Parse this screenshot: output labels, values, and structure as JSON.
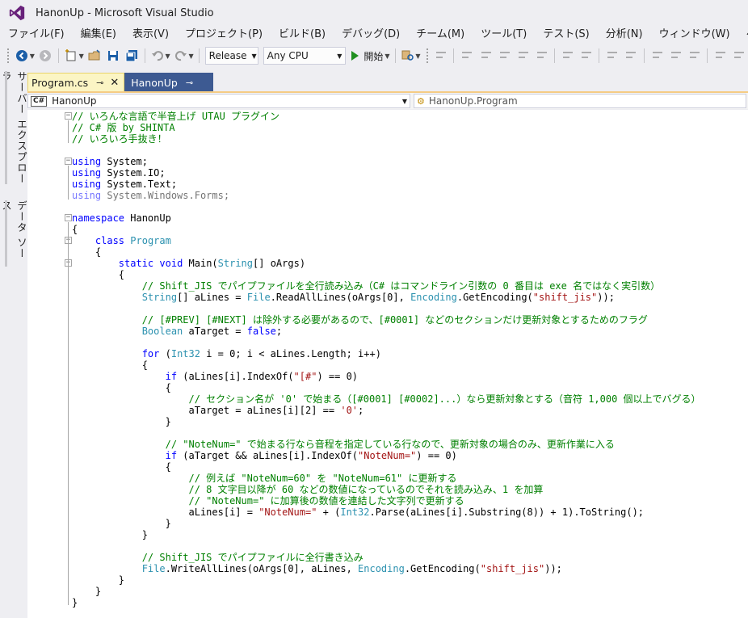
{
  "window": {
    "title": "HanonUp - Microsoft Visual Studio"
  },
  "menu": [
    "ファイル(F)",
    "編集(E)",
    "表示(V)",
    "プロジェクト(P)",
    "ビルド(B)",
    "デバッグ(D)",
    "チーム(M)",
    "ツール(T)",
    "テスト(S)",
    "分析(N)",
    "ウィンドウ(W)",
    "ヘルプ(H)"
  ],
  "toolbar": {
    "config": "Release",
    "platform": "Any CPU",
    "start_label": "開始"
  },
  "sidebar": {
    "server_explorer": "サーバー エクスプローラー",
    "data_sources": "データ ソース"
  },
  "tabs": [
    {
      "label": "Program.cs",
      "active": true
    },
    {
      "label": "HanonUp",
      "active": false
    }
  ],
  "navbar": {
    "project": "HanonUp",
    "project_badge": "C#",
    "member": "HanonUp.Program"
  },
  "code": [
    [
      [
        "cmt",
        "// いろんな言語で半音上げ UTAU プラグイン"
      ]
    ],
    [
      [
        "cmt",
        "// C# 版 by SHINTA"
      ]
    ],
    [
      [
        "cmt",
        "// いろいろ手抜き！"
      ]
    ],
    [
      [
        "txt",
        ""
      ]
    ],
    [
      [
        "kw",
        "using"
      ],
      [
        "txt",
        " System;"
      ]
    ],
    [
      [
        "kw",
        "using"
      ],
      [
        "txt",
        " System.IO;"
      ]
    ],
    [
      [
        "kw",
        "using"
      ],
      [
        "txt",
        " System.Text;"
      ]
    ],
    [
      [
        "kwdim",
        "using"
      ],
      [
        "dim",
        " System.Windows.Forms;"
      ]
    ],
    [
      [
        "txt",
        ""
      ]
    ],
    [
      [
        "kw",
        "namespace"
      ],
      [
        "txt",
        " HanonUp"
      ]
    ],
    [
      [
        "txt",
        "{"
      ]
    ],
    [
      [
        "txt",
        "    "
      ],
      [
        "kw",
        "class"
      ],
      [
        "txt",
        " "
      ],
      [
        "ty",
        "Program"
      ]
    ],
    [
      [
        "txt",
        "    {"
      ]
    ],
    [
      [
        "txt",
        "        "
      ],
      [
        "kw",
        "static"
      ],
      [
        "txt",
        " "
      ],
      [
        "kw",
        "void"
      ],
      [
        "txt",
        " Main("
      ],
      [
        "ty",
        "String"
      ],
      [
        "txt",
        "[] oArgs)"
      ]
    ],
    [
      [
        "txt",
        "        {"
      ]
    ],
    [
      [
        "txt",
        "            "
      ],
      [
        "cmt",
        "// Shift_JIS でパイプファイルを全行読み込み（C# はコマンドライン引数の 0 番目は exe 名ではなく実引数）"
      ]
    ],
    [
      [
        "txt",
        "            "
      ],
      [
        "ty",
        "String"
      ],
      [
        "txt",
        "[] aLines = "
      ],
      [
        "ty",
        "File"
      ],
      [
        "txt",
        ".ReadAllLines(oArgs[0], "
      ],
      [
        "ty",
        "Encoding"
      ],
      [
        "txt",
        ".GetEncoding("
      ],
      [
        "str",
        "\"shift_jis\""
      ],
      [
        "txt",
        "));"
      ]
    ],
    [
      [
        "txt",
        ""
      ]
    ],
    [
      [
        "txt",
        "            "
      ],
      [
        "cmt",
        "// [#PREV] [#NEXT] は除外する必要があるので、[#0001] などのセクションだけ更新対象とするためのフラグ"
      ]
    ],
    [
      [
        "txt",
        "            "
      ],
      [
        "ty",
        "Boolean"
      ],
      [
        "txt",
        " aTarget = "
      ],
      [
        "kw",
        "false"
      ],
      [
        "txt",
        ";"
      ]
    ],
    [
      [
        "txt",
        ""
      ]
    ],
    [
      [
        "txt",
        "            "
      ],
      [
        "kw",
        "for"
      ],
      [
        "txt",
        " ("
      ],
      [
        "ty",
        "Int32"
      ],
      [
        "txt",
        " i = 0; i < aLines.Length; i++)"
      ]
    ],
    [
      [
        "txt",
        "            {"
      ]
    ],
    [
      [
        "txt",
        "                "
      ],
      [
        "kw",
        "if"
      ],
      [
        "txt",
        " (aLines[i].IndexOf("
      ],
      [
        "str",
        "\"[#\""
      ],
      [
        "txt",
        ") == 0)"
      ]
    ],
    [
      [
        "txt",
        "                {"
      ]
    ],
    [
      [
        "txt",
        "                    "
      ],
      [
        "cmt",
        "// セクション名が '0' で始まる（[#0001] [#0002]...）なら更新対象とする（音符 1,000 個以上でバグる）"
      ]
    ],
    [
      [
        "txt",
        "                    aTarget = aLines[i][2] == "
      ],
      [
        "str",
        "'0'"
      ],
      [
        "txt",
        ";"
      ]
    ],
    [
      [
        "txt",
        "                }"
      ]
    ],
    [
      [
        "txt",
        ""
      ]
    ],
    [
      [
        "txt",
        "                "
      ],
      [
        "cmt",
        "// \"NoteNum=\" で始まる行なら音程を指定している行なので、更新対象の場合のみ、更新作業に入る"
      ]
    ],
    [
      [
        "txt",
        "                "
      ],
      [
        "kw",
        "if"
      ],
      [
        "txt",
        " (aTarget && aLines[i].IndexOf("
      ],
      [
        "str",
        "\"NoteNum=\""
      ],
      [
        "txt",
        ") == 0)"
      ]
    ],
    [
      [
        "txt",
        "                {"
      ]
    ],
    [
      [
        "txt",
        "                    "
      ],
      [
        "cmt",
        "// 例えば \"NoteNum=60\" を \"NoteNum=61\" に更新する"
      ]
    ],
    [
      [
        "txt",
        "                    "
      ],
      [
        "cmt",
        "// 8 文字目以降が 60 などの数値になっているのでそれを読み込み、1 を加算"
      ]
    ],
    [
      [
        "txt",
        "                    "
      ],
      [
        "cmt",
        "// \"NoteNum=\" に加算後の数値を連結した文字列で更新する"
      ]
    ],
    [
      [
        "txt",
        "                    aLines[i] = "
      ],
      [
        "str",
        "\"NoteNum=\""
      ],
      [
        "txt",
        " + ("
      ],
      [
        "ty",
        "Int32"
      ],
      [
        "txt",
        ".Parse(aLines[i].Substring(8)) + 1).ToString();"
      ]
    ],
    [
      [
        "txt",
        "                }"
      ]
    ],
    [
      [
        "txt",
        "            }"
      ]
    ],
    [
      [
        "txt",
        ""
      ]
    ],
    [
      [
        "txt",
        "            "
      ],
      [
        "cmt",
        "// Shift_JIS でパイプファイルに全行書き込み"
      ]
    ],
    [
      [
        "txt",
        "            "
      ],
      [
        "ty",
        "File"
      ],
      [
        "txt",
        ".WriteAllLines(oArgs[0], aLines, "
      ],
      [
        "ty",
        "Encoding"
      ],
      [
        "txt",
        ".GetEncoding("
      ],
      [
        "str",
        "\"shift_jis\""
      ],
      [
        "txt",
        "));"
      ]
    ],
    [
      [
        "txt",
        "        }"
      ]
    ],
    [
      [
        "txt",
        "    }"
      ]
    ],
    [
      [
        "txt",
        "}"
      ]
    ]
  ],
  "colors": {
    "comment": "#008000",
    "keyword": "#0000ff",
    "type": "#2b91af",
    "string": "#a31515",
    "active_tab": "#fbf5c4",
    "inactive_tab": "#3d5a92",
    "vs_purple": "#68217a"
  },
  "icons": [
    "visual-studio-logo-icon",
    "back-icon",
    "forward-icon",
    "new-project-icon",
    "open-file-icon",
    "save-icon",
    "save-all-icon",
    "undo-icon",
    "redo-icon",
    "start-play-icon",
    "find-icon",
    "pin-icon",
    "close-icon",
    "csharp-file-icon",
    "class-member-icon"
  ]
}
